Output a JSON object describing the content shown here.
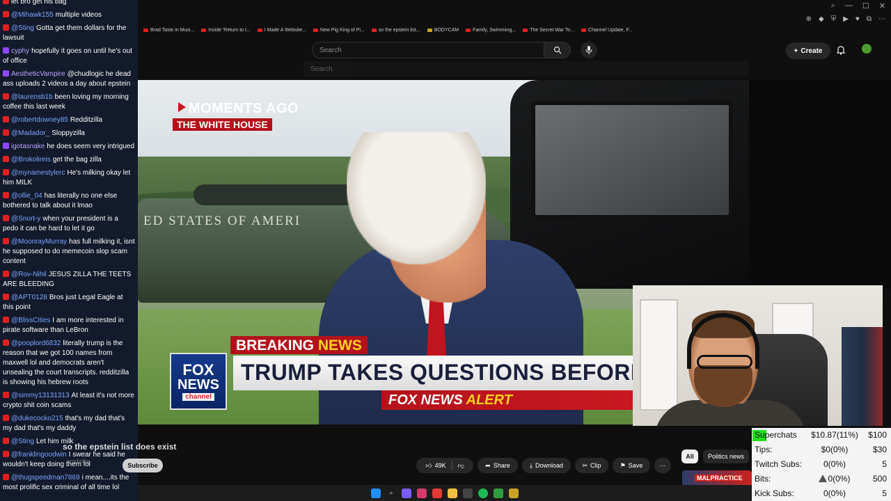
{
  "chat": {
    "top_partial": "let bro get his bag",
    "messages": [
      {
        "platform": "yt",
        "user": "@Mihawk155",
        "text": "multiple videos"
      },
      {
        "platform": "yt",
        "user": "@Sting",
        "text": "Gotta get them dollars for the lawsuit"
      },
      {
        "platform": "tw",
        "user": "cyphy",
        "text": "hopefully it goes on until he's out of office"
      },
      {
        "platform": "tw",
        "user": "AestheticVampire",
        "text": "@chudlogic he dead ass uploads 2 videos a day about epstein"
      },
      {
        "platform": "yt",
        "user": "@laurensb1b",
        "text": "been loving my morning coffee this last week"
      },
      {
        "platform": "yt",
        "user": "@robertdowney85",
        "text": "Redditzilla"
      },
      {
        "platform": "yt",
        "user": "@Madador_",
        "text": "Sloppyzilla"
      },
      {
        "platform": "tw",
        "user": "igotasnake",
        "text": "he does seem very intrigued"
      },
      {
        "platform": "yt",
        "user": "@Brokolireis",
        "text": "get the bag zilla"
      },
      {
        "platform": "yt",
        "user": "@mynamestylerc",
        "text": "He's milking okay let him MILK"
      },
      {
        "platform": "yt",
        "user": "@ollie_04",
        "text": "has literally no one else bothered to talk about it lmao"
      },
      {
        "platform": "yt",
        "user": "@Snort-y",
        "text": "when your president is a pedo it can be hard to let it go"
      },
      {
        "platform": "yt",
        "user": "@MoonrayMurray",
        "text": "has full milking it, isnt he supposed to do memecoin slop scam content"
      },
      {
        "platform": "yt",
        "user": "@Rov-Nihil",
        "text": "JESUS ZILLA THE TEETS ARE BLEEDING"
      },
      {
        "platform": "yt",
        "user": "@APT0128",
        "text": "Bros just Legal Eagle at this point"
      },
      {
        "platform": "yt",
        "user": "@BlissCities",
        "text": "I am more interested in pirate software than LeBron"
      },
      {
        "platform": "yt",
        "user": "@pooplord6832",
        "text": "literally trump is the reason that we got 100 names from maxwell lol and democrats aren't unsealing the court transcripts. redditzilla is showing his hebrew roots"
      },
      {
        "platform": "yt",
        "user": "@simmy13131313",
        "text": "At least it's not more crypto shit coin scams"
      },
      {
        "platform": "yt",
        "user": "@dukecocko215",
        "text": "that's my dad that's my dad that's my daddy"
      },
      {
        "platform": "yt",
        "user": "@Sting",
        "text": "Let him milk"
      },
      {
        "platform": "yt",
        "user": "@franklingoodwin",
        "text": "I swear he said he wouldn't keep doing them lol"
      },
      {
        "platform": "yt",
        "user": "@thugspeedman7869",
        "text": "i mean....its the most prolific sex criminal of all time lol"
      }
    ]
  },
  "browser": {
    "bookmarks": [
      {
        "label": "Brad Taste in Musi...",
        "type": "yt"
      },
      {
        "label": "Inside 'Return to t...",
        "type": "yt"
      },
      {
        "label": "I Made A Website...",
        "type": "yt"
      },
      {
        "label": "New Pig King of Pi...",
        "type": "yt"
      },
      {
        "label": "so the epstein list...",
        "type": "yt"
      },
      {
        "label": "BODYCAM",
        "type": "folder"
      },
      {
        "label": "Family, Swimming...",
        "type": "yt"
      },
      {
        "label": "The Secret War To...",
        "type": "yt"
      },
      {
        "label": "Channel Update, F...",
        "type": "yt"
      }
    ]
  },
  "yt": {
    "search_placeholder": "Search",
    "create_label": "Create",
    "ghost_search": "Search"
  },
  "video": {
    "moments": "MOMENTS AGO",
    "location": "THE WHITE HOUSE",
    "heli_text": "ED STATES OF AMERI",
    "breaking": "BREAKING",
    "breaking_news": "NEWS",
    "headline": "TRUMP TAKES QUESTIONS BEFORE SCOTLA",
    "alert_fox": "FOX NEWS",
    "alert_word": "ALERT",
    "logo_fox": "FOX",
    "logo_news": "NEWS",
    "logo_channel": "channel"
  },
  "info": {
    "title": "so the epstein list does exist",
    "channel": "voidzilla",
    "subscribe": "Subscribe",
    "likes": "49K",
    "share": "Share",
    "download": "Download",
    "clip": "Clip",
    "save": "Save",
    "chip_all": "All",
    "chip_politics": "Politics news",
    "thumb_label": "MALPRACTICE"
  },
  "stats": {
    "rows": [
      {
        "label": "Superchats",
        "value": "$10.87(11%)",
        "goal": "$100"
      },
      {
        "label": "Tips:",
        "value": "$0(0%)",
        "goal": "$30"
      },
      {
        "label": "Twitch Subs:",
        "value": "0(0%)",
        "goal": "5"
      },
      {
        "label": "Bits:",
        "value": "0(0%)",
        "goal": "500"
      },
      {
        "label": "Kick Subs:",
        "value": "0(0%)",
        "goal": "5"
      }
    ],
    "highlight_color": "#1fe01f"
  }
}
